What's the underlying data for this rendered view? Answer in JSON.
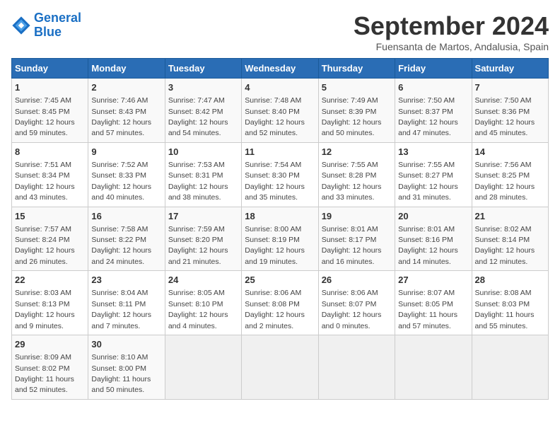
{
  "logo": {
    "line1": "General",
    "line2": "Blue"
  },
  "title": "September 2024",
  "location": "Fuensanta de Martos, Andalusia, Spain",
  "days_header": [
    "Sunday",
    "Monday",
    "Tuesday",
    "Wednesday",
    "Thursday",
    "Friday",
    "Saturday"
  ],
  "weeks": [
    [
      {
        "day": "1",
        "detail": "Sunrise: 7:45 AM\nSunset: 8:45 PM\nDaylight: 12 hours\nand 59 minutes."
      },
      {
        "day": "2",
        "detail": "Sunrise: 7:46 AM\nSunset: 8:43 PM\nDaylight: 12 hours\nand 57 minutes."
      },
      {
        "day": "3",
        "detail": "Sunrise: 7:47 AM\nSunset: 8:42 PM\nDaylight: 12 hours\nand 54 minutes."
      },
      {
        "day": "4",
        "detail": "Sunrise: 7:48 AM\nSunset: 8:40 PM\nDaylight: 12 hours\nand 52 minutes."
      },
      {
        "day": "5",
        "detail": "Sunrise: 7:49 AM\nSunset: 8:39 PM\nDaylight: 12 hours\nand 50 minutes."
      },
      {
        "day": "6",
        "detail": "Sunrise: 7:50 AM\nSunset: 8:37 PM\nDaylight: 12 hours\nand 47 minutes."
      },
      {
        "day": "7",
        "detail": "Sunrise: 7:50 AM\nSunset: 8:36 PM\nDaylight: 12 hours\nand 45 minutes."
      }
    ],
    [
      {
        "day": "8",
        "detail": "Sunrise: 7:51 AM\nSunset: 8:34 PM\nDaylight: 12 hours\nand 43 minutes."
      },
      {
        "day": "9",
        "detail": "Sunrise: 7:52 AM\nSunset: 8:33 PM\nDaylight: 12 hours\nand 40 minutes."
      },
      {
        "day": "10",
        "detail": "Sunrise: 7:53 AM\nSunset: 8:31 PM\nDaylight: 12 hours\nand 38 minutes."
      },
      {
        "day": "11",
        "detail": "Sunrise: 7:54 AM\nSunset: 8:30 PM\nDaylight: 12 hours\nand 35 minutes."
      },
      {
        "day": "12",
        "detail": "Sunrise: 7:55 AM\nSunset: 8:28 PM\nDaylight: 12 hours\nand 33 minutes."
      },
      {
        "day": "13",
        "detail": "Sunrise: 7:55 AM\nSunset: 8:27 PM\nDaylight: 12 hours\nand 31 minutes."
      },
      {
        "day": "14",
        "detail": "Sunrise: 7:56 AM\nSunset: 8:25 PM\nDaylight: 12 hours\nand 28 minutes."
      }
    ],
    [
      {
        "day": "15",
        "detail": "Sunrise: 7:57 AM\nSunset: 8:24 PM\nDaylight: 12 hours\nand 26 minutes."
      },
      {
        "day": "16",
        "detail": "Sunrise: 7:58 AM\nSunset: 8:22 PM\nDaylight: 12 hours\nand 24 minutes."
      },
      {
        "day": "17",
        "detail": "Sunrise: 7:59 AM\nSunset: 8:20 PM\nDaylight: 12 hours\nand 21 minutes."
      },
      {
        "day": "18",
        "detail": "Sunrise: 8:00 AM\nSunset: 8:19 PM\nDaylight: 12 hours\nand 19 minutes."
      },
      {
        "day": "19",
        "detail": "Sunrise: 8:01 AM\nSunset: 8:17 PM\nDaylight: 12 hours\nand 16 minutes."
      },
      {
        "day": "20",
        "detail": "Sunrise: 8:01 AM\nSunset: 8:16 PM\nDaylight: 12 hours\nand 14 minutes."
      },
      {
        "day": "21",
        "detail": "Sunrise: 8:02 AM\nSunset: 8:14 PM\nDaylight: 12 hours\nand 12 minutes."
      }
    ],
    [
      {
        "day": "22",
        "detail": "Sunrise: 8:03 AM\nSunset: 8:13 PM\nDaylight: 12 hours\nand 9 minutes."
      },
      {
        "day": "23",
        "detail": "Sunrise: 8:04 AM\nSunset: 8:11 PM\nDaylight: 12 hours\nand 7 minutes."
      },
      {
        "day": "24",
        "detail": "Sunrise: 8:05 AM\nSunset: 8:10 PM\nDaylight: 12 hours\nand 4 minutes."
      },
      {
        "day": "25",
        "detail": "Sunrise: 8:06 AM\nSunset: 8:08 PM\nDaylight: 12 hours\nand 2 minutes."
      },
      {
        "day": "26",
        "detail": "Sunrise: 8:06 AM\nSunset: 8:07 PM\nDaylight: 12 hours\nand 0 minutes."
      },
      {
        "day": "27",
        "detail": "Sunrise: 8:07 AM\nSunset: 8:05 PM\nDaylight: 11 hours\nand 57 minutes."
      },
      {
        "day": "28",
        "detail": "Sunrise: 8:08 AM\nSunset: 8:03 PM\nDaylight: 11 hours\nand 55 minutes."
      }
    ],
    [
      {
        "day": "29",
        "detail": "Sunrise: 8:09 AM\nSunset: 8:02 PM\nDaylight: 11 hours\nand 52 minutes."
      },
      {
        "day": "30",
        "detail": "Sunrise: 8:10 AM\nSunset: 8:00 PM\nDaylight: 11 hours\nand 50 minutes."
      },
      null,
      null,
      null,
      null,
      null
    ]
  ]
}
